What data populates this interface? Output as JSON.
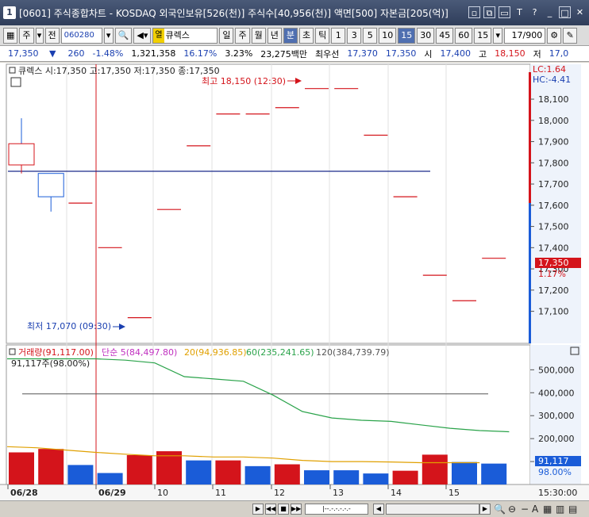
{
  "window": {
    "number": "1",
    "title": "[0601] 주식종합차트 - KOSDAQ 외국인보유[526(천)] 주식수[40,956(천)] 액면[500] 자본금[205(억)]",
    "buttons": [
      "□",
      "⧉",
      "☐",
      "T",
      "?",
      "_",
      "□",
      "×"
    ]
  },
  "toolbar": {
    "market": "주",
    "all": "전",
    "code": "060280",
    "name_tag": "열",
    "name": "큐렉스",
    "periods": [
      "일",
      "주",
      "월",
      "년",
      "분",
      "초",
      "틱"
    ],
    "selected_period": "분",
    "intervals": [
      "1",
      "3",
      "5",
      "10",
      "15",
      "30",
      "45",
      "60"
    ],
    "selected_interval": "15",
    "interval_value": "15",
    "count": "17/900"
  },
  "quote": {
    "price": "17,350",
    "change_arrow": "▼",
    "change": "260",
    "change_pct": "-1.48%",
    "volume": "1,321,358",
    "rate1": "16.17%",
    "rate2": "3.23%",
    "amount": "23,275백만",
    "pref_label": "최우선",
    "pref_ask": "17,370",
    "pref_bid": "17,350",
    "open_label": "시",
    "open": "17,400",
    "high_label": "고",
    "high": "18,150",
    "low_label": "저",
    "low": "17,0"
  },
  "price_chart": {
    "legend": "큐렉스 시:17,350 고:17,350 저:17,350 종:17,350",
    "lc_label": "LC:1.64",
    "hc_label": "HC:-4.41",
    "max_annot": "최고 18,150 (12:30)",
    "min_annot": "최저 17,070 (09:30)",
    "current_label": "17,350",
    "current_pct": "1.17%",
    "y_ticks": [
      "18,100",
      "18,000",
      "17,900",
      "17,800",
      "17,700",
      "17,600",
      "17,500",
      "17,400",
      "17,300",
      "17,200",
      "17,100"
    ]
  },
  "volume_chart": {
    "legend_vol": "거래량(91,117.00)",
    "legend_ma5": "단순 5(84,497.80)",
    "legend_ma20": "20(94,936.85)",
    "legend_ma60": "60(235,241.65)",
    "legend_ma120": "120(384,739.79)",
    "sub_legend": "91,117주(98.00%)",
    "current_label": "91,117",
    "current_pct": "98.00%",
    "y_ticks": [
      "500,000",
      "400,000",
      "300,000",
      "200,000",
      "100,000"
    ]
  },
  "x_axis": {
    "labels": [
      "06/28",
      "06/29",
      "10",
      "11",
      "12",
      "13",
      "14",
      "15"
    ],
    "end_label": "15:30:00"
  },
  "colors": {
    "up": "#d4141b",
    "down": "#1a5cd8",
    "ma_green": "#2aa34a",
    "ma_orange": "#e0a000",
    "ma_purple": "#c030c0",
    "hline": "#1a2a8a"
  },
  "chart_data": {
    "type": "candlestick",
    "x": [
      "06/28",
      "06/29 09:30",
      "09:45",
      "10:00",
      "10:15",
      "10:30",
      "10:45",
      "11:00",
      "11:15",
      "11:30",
      "11:45",
      "12:00",
      "12:15",
      "12:30",
      "12:45",
      "13:00",
      "13:15"
    ],
    "candles": [
      {
        "open": 17790,
        "high": 17810,
        "low": 17750,
        "close": 17890,
        "upper": 18010,
        "lower": 17750
      },
      {
        "open": 17750,
        "high": 17750,
        "low": 17570,
        "close": 17640
      },
      {
        "open": 17610,
        "high": 17610,
        "low": 17610,
        "close": 17610
      },
      {
        "open": 17400,
        "high": 17400,
        "low": 17400,
        "close": 17400
      },
      {
        "open": 17070,
        "high": 17070,
        "low": 17070,
        "close": 17070
      },
      {
        "open": 17580,
        "high": 17580,
        "low": 17580,
        "close": 17580
      },
      {
        "open": 17880,
        "high": 17880,
        "low": 17880,
        "close": 17880
      },
      {
        "open": 18030,
        "high": 18030,
        "low": 18030,
        "close": 18030
      },
      {
        "open": 18030,
        "high": 18030,
        "low": 18030,
        "close": 18030
      },
      {
        "open": 18060,
        "high": 18060,
        "low": 18060,
        "close": 18060
      },
      {
        "open": 18150,
        "high": 18150,
        "low": 18150,
        "close": 18150
      },
      {
        "open": 18150,
        "high": 18150,
        "low": 18150,
        "close": 18150
      },
      {
        "open": 17930,
        "high": 17930,
        "low": 17930,
        "close": 17930
      },
      {
        "open": 17640,
        "high": 17640,
        "low": 17640,
        "close": 17640
      },
      {
        "open": 17270,
        "high": 17270,
        "low": 17270,
        "close": 17270
      },
      {
        "open": 17150,
        "high": 17150,
        "low": 17150,
        "close": 17150
      },
      {
        "open": 17350,
        "high": 17350,
        "low": 17350,
        "close": 17350
      }
    ],
    "volume": [
      140000,
      155000,
      85000,
      50000,
      128000,
      145000,
      105000,
      105000,
      80000,
      88000,
      62000,
      62000,
      48000,
      60000,
      130000,
      98000,
      91117
    ],
    "volume_up": [
      true,
      true,
      false,
      false,
      true,
      true,
      false,
      true,
      false,
      true,
      false,
      false,
      false,
      true,
      true,
      false,
      false
    ],
    "ma60": [
      548000,
      548000,
      548000,
      548000,
      542000,
      530000,
      470000,
      460000,
      450000,
      390000,
      318000,
      290000,
      280000,
      275000,
      260000,
      245000,
      235000,
      230000
    ],
    "ma_orange": [
      165000,
      160000,
      150000,
      140000,
      132000,
      125000,
      125000,
      120000,
      120000,
      115000,
      105000,
      100000,
      100000,
      98000,
      95000,
      95000,
      94936
    ],
    "hline": 17760,
    "vol_hline": 395000,
    "ylim": [
      17020,
      18160
    ],
    "vol_ylim": [
      0,
      560000
    ]
  }
}
